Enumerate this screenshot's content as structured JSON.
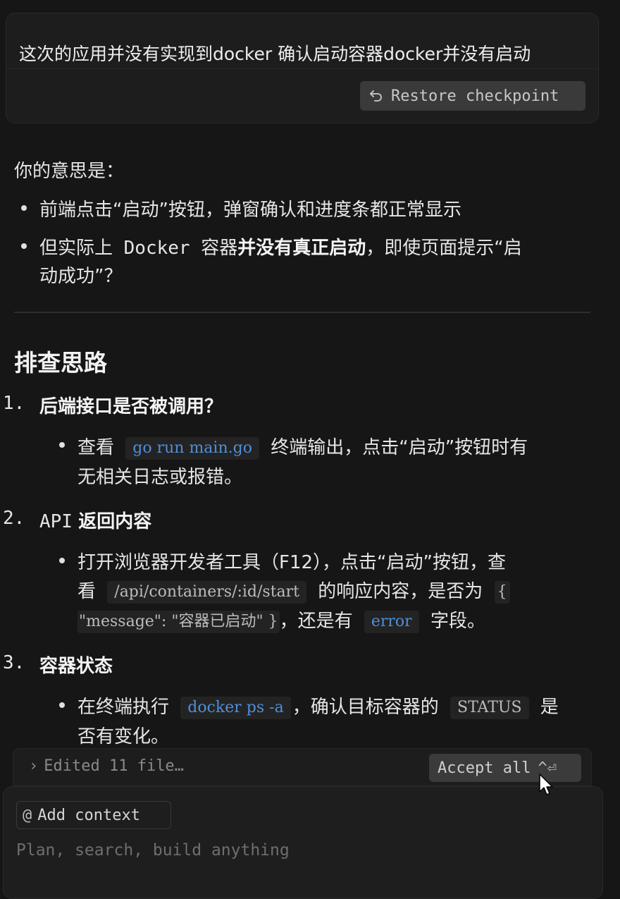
{
  "user_message": {
    "text": "这次的应用并没有实现到docker 确认启动容器docker并没有启动",
    "restore_label": "Restore checkpoint"
  },
  "assistant": {
    "intro": "你的意思是：",
    "bullets": [
      {
        "text": "前端点击“启动”按钮，弹窗确认和进度条都正常显示"
      },
      {
        "prefix": "但实际上 Docker 容器",
        "bold": "并没有真正启动",
        "suffix": "，即使页面提示“启",
        "line2": "动成功”？"
      }
    ],
    "heading": "排查思路",
    "steps": [
      {
        "number": "1.",
        "title": "后端接口是否被调用？",
        "detail": {
          "pre": "查看",
          "code": "go run main.go",
          "post": "终端输出，点击“启动”按钮时有",
          "line2": "无相关日志或报错。"
        }
      },
      {
        "number": "2.",
        "title_mono": "API",
        "title": "返回内容",
        "detail": {
          "line1": "打开浏览器开发者工具（F12），点击“启动”按钮，查",
          "line2_pre": "看",
          "code1": "/api/containers/:id/start",
          "line2_post": "的响应内容，是否为",
          "code2a": "{",
          "code2b": "\"message\": \"容器已启动\" }",
          "line3_post": "，还是有",
          "code3": "error",
          "line3_end": "字段。"
        }
      },
      {
        "number": "3.",
        "title": "容器状态",
        "detail": {
          "pre": "在终端执行",
          "code": "docker ps -a",
          "post": "，确认目标容器的",
          "code2": "STATUS",
          "end": "是",
          "line2": "否有变化。"
        }
      }
    ]
  },
  "edits_bar": {
    "label": "Edited 11 file…",
    "accept_label": "Accept all",
    "accept_shortcut": "^⏎"
  },
  "composer": {
    "context_label": "Add context",
    "placeholder": "Plan, search, build anything"
  }
}
